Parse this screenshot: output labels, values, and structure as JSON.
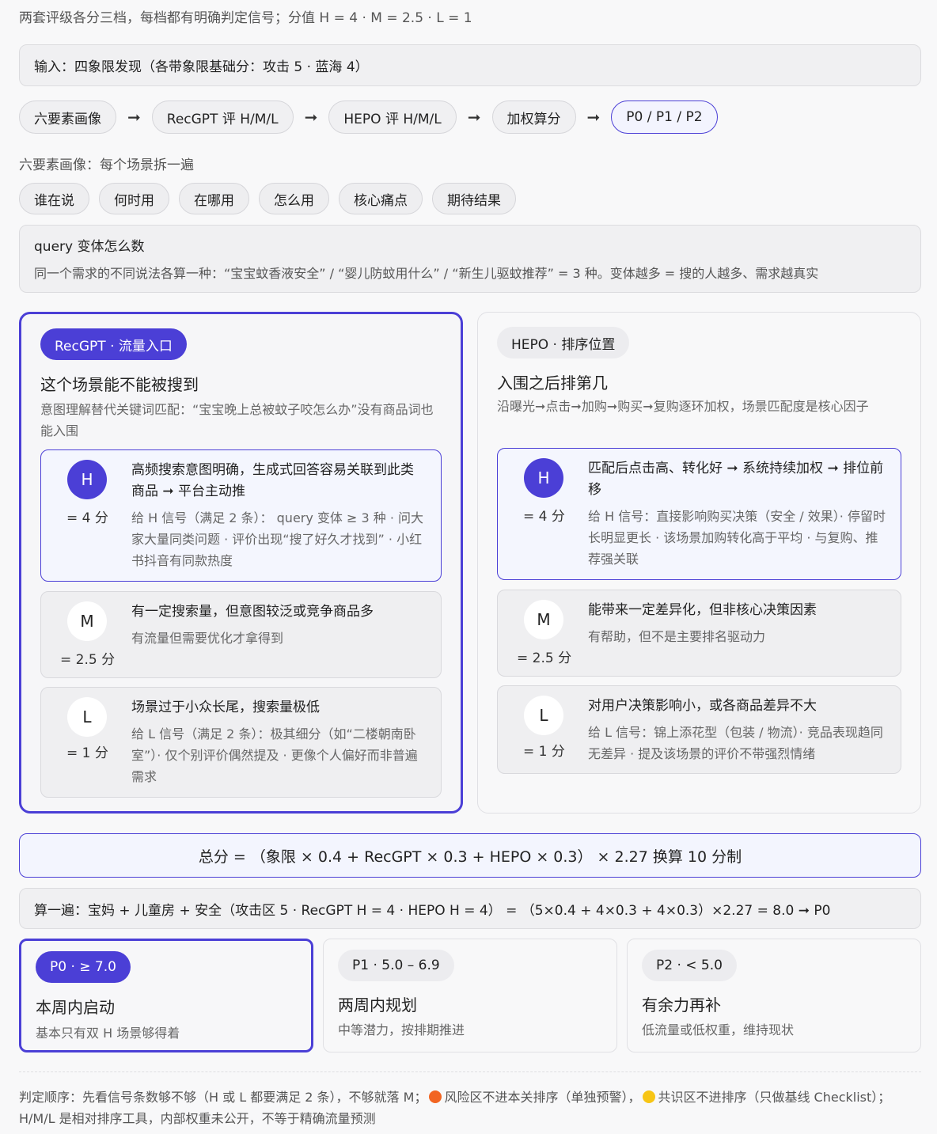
{
  "intro": "两套评级各分三档，每档都有明确判定信号；分值 H = 4 · M = 2.5 · L = 1",
  "input": "输入：四象限发现（各带象限基础分：攻击 5 · 蓝海 4）",
  "flow": {
    "steps": [
      "六要素画像",
      "RecGPT 评 H/M/L",
      "HEPO 评 H/M/L",
      "加权算分",
      "P0 / P1 / P2"
    ],
    "arrow": "➞"
  },
  "six_elements": {
    "label": "六要素画像：每个场景拆一遍",
    "tags": [
      "谁在说",
      "何时用",
      "在哪用",
      "怎么用",
      "核心痛点",
      "期待结果"
    ]
  },
  "query": {
    "title": "query 变体怎么数",
    "text": "同一个需求的不同说法各算一种：“宝宝蚊香液安全” / “婴儿防蚊用什么” / “新生儿驱蚊推荐” = 3 种。变体越多 = 搜的人越多、需求越真实"
  },
  "recgpt": {
    "badge": "RecGPT · 流量入口",
    "title": "这个场景能不能被搜到",
    "desc": "意图理解替代关键词匹配：“宝宝晚上总被蚊子咬怎么办”没有商品词也能入围",
    "levels": [
      {
        "letter": "H",
        "score": "= 4 分",
        "title": "高频搜索意图明确，生成式回答容易关联到此类商品 ➞ 平台主动推",
        "text": "给 H 信号（满足 2 条）： query 变体 ≥ 3 种 · 问大家大量同类问题 · 评价出现“搜了好久才找到” · 小红书抖音有同款热度"
      },
      {
        "letter": "M",
        "score": "= 2.5 分",
        "title": "有一定搜索量，但意图较泛或竞争商品多",
        "text": "有流量但需要优化才拿得到"
      },
      {
        "letter": "L",
        "score": "= 1 分",
        "title": "场景过于小众长尾，搜索量极低",
        "text": "给 L 信号（满足 2 条）：极其细分（如“二楼朝南卧室”）· 仅个别评价偶然提及 · 更像个人偏好而非普遍需求"
      }
    ]
  },
  "hepo": {
    "badge": "HEPO · 排序位置",
    "title": "入围之后排第几",
    "desc": "沿曝光➞点击➞加购➞购买➞复购逐环加权，场景匹配度是核心因子",
    "levels": [
      {
        "letter": "H",
        "score": "= 4 分",
        "title": "匹配后点击高、转化好 ➞ 系统持续加权 ➞ 排位前移",
        "text": "给 H 信号：直接影响购买决策（安全 / 效果）· 停留时长明显更长 · 该场景加购转化高于平均 · 与复购、推荐强关联"
      },
      {
        "letter": "M",
        "score": "= 2.5 分",
        "title": "能带来一定差异化，但非核心决策因素",
        "text": "有帮助，但不是主要排名驱动力"
      },
      {
        "letter": "L",
        "score": "= 1 分",
        "title": "对用户决策影响小，或各商品差异不大",
        "text": "给 L 信号：锦上添花型（包装 / 物流）· 竞品表现趋同无差异 · 提及该场景的评价不带强烈情绪"
      }
    ]
  },
  "formula": "总分 = （象限 × 0.4 + RecGPT × 0.3 + HEPO × 0.3） × 2.27 换算 10 分制",
  "example": "算一遍：宝妈 + 儿童房 + 安全（攻击区 5 · RecGPT H = 4 · HEPO H = 4） = （5×0.4 + 4×0.3 + 4×0.3）×2.27 = 8.0 ➞ P0",
  "priorities": [
    {
      "badge": "P0 · ≥ 7.0",
      "title": "本周内启动",
      "desc": "基本只有双 H 场景够得着"
    },
    {
      "badge": "P1 · 5.0 – 6.9",
      "title": "两周内规划",
      "desc": "中等潜力，按排期推进"
    },
    {
      "badge": "P2 · < 5.0",
      "title": "有余力再补",
      "desc": "低流量或低权重，维持现状"
    }
  ],
  "footer": {
    "part1": "判定顺序：先看信号条数够不够（H 或 L 都要满足 2 条），不够就落 M；",
    "part2": "风险区不进本关排序（单独预警），",
    "part3": "共识区不进排序（只做基线 Checklist）；H/M/L 是相对排序工具，内部权重未公开，不等于精确流量预测"
  },
  "colors": {
    "accent": "#4b3fd6",
    "risk": "#f26522",
    "consensus": "#f7c515"
  }
}
